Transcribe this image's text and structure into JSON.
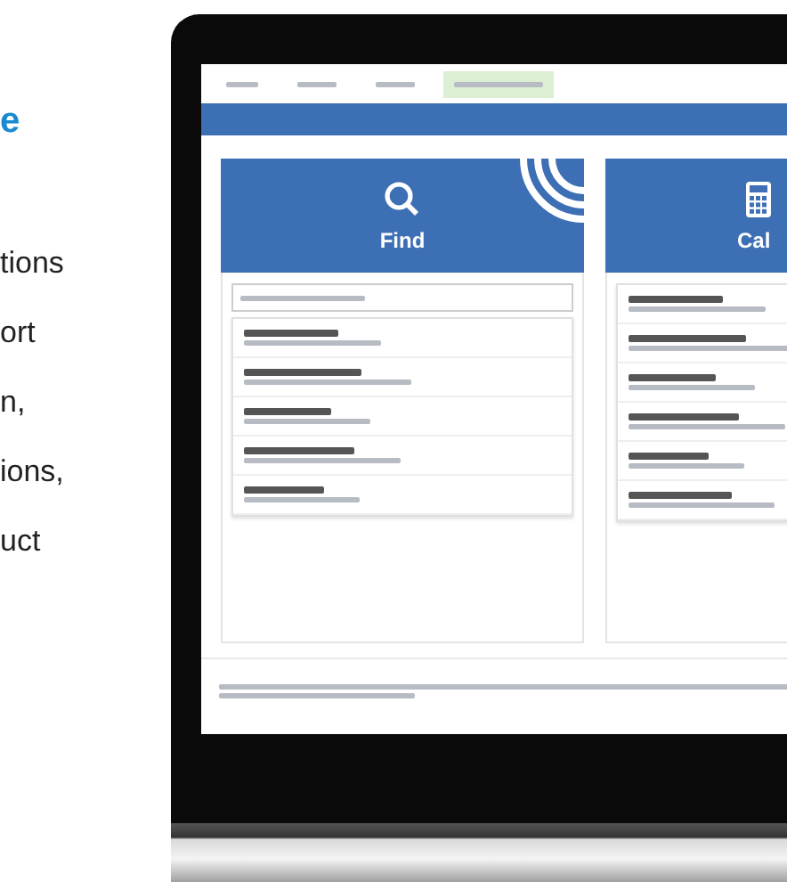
{
  "side_text": [
    {
      "kind": "heading",
      "text": "e"
    },
    {
      "kind": "body",
      "text": "tions"
    },
    {
      "kind": "body",
      "text": "ort"
    },
    {
      "kind": "body",
      "text": "n,"
    },
    {
      "kind": "body",
      "text": "ions,"
    },
    {
      "kind": "body",
      "text": "uct"
    }
  ],
  "top_links": [
    {
      "selected": false
    },
    {
      "selected": false
    },
    {
      "selected": false
    },
    {
      "selected": true
    }
  ],
  "cards": [
    {
      "kind": "find",
      "title": "Find"
    },
    {
      "kind": "calculate",
      "title": "Cal"
    }
  ]
}
